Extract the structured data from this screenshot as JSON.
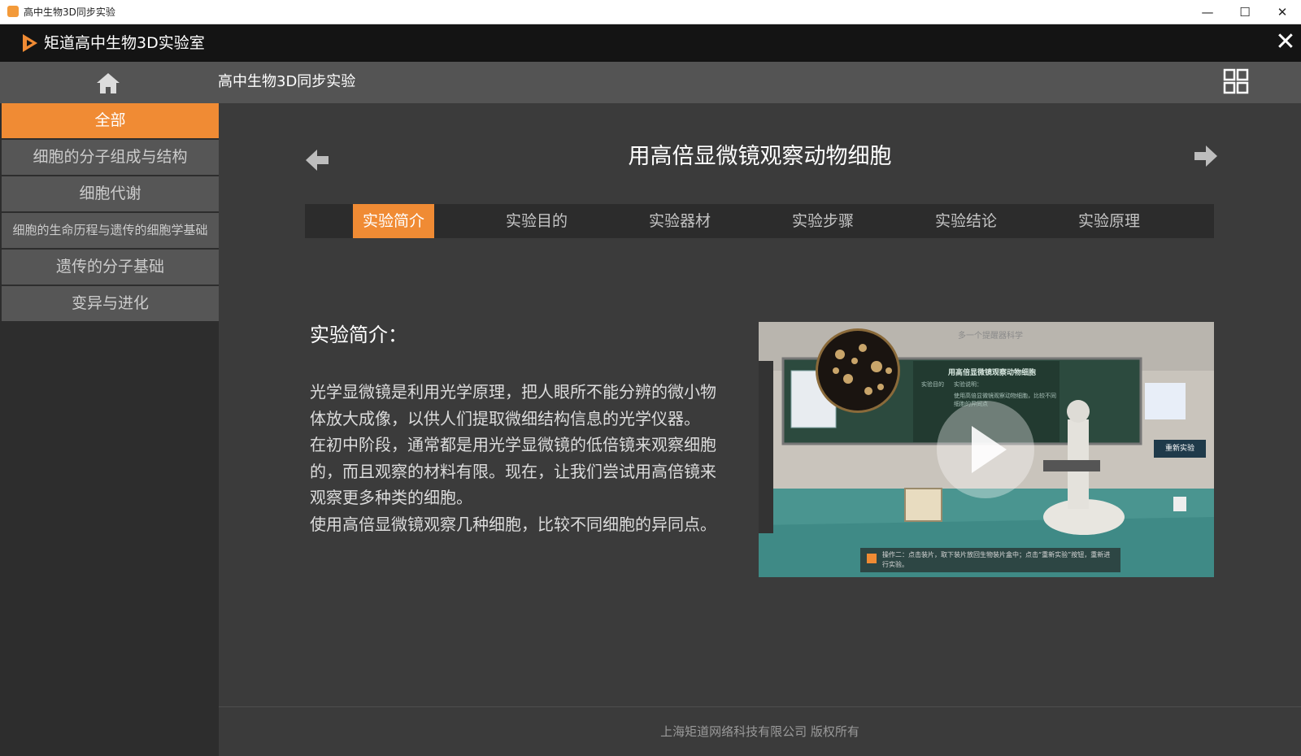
{
  "window": {
    "title": "高中生物3D同步实验",
    "minimize_label": "—",
    "maximize_label": "☐",
    "close_label": "✕"
  },
  "app": {
    "title": "矩道高中生物3D实验室",
    "close_label": "✕",
    "accent_color": "#f08b34"
  },
  "nav": {
    "title": "高中生物3D同步实验",
    "home_icon": "home-icon",
    "menu_icon": "grid-icon"
  },
  "sidebar": {
    "items": [
      {
        "label": "全部",
        "active": true
      },
      {
        "label": "细胞的分子组成与结构",
        "active": false
      },
      {
        "label": "细胞代谢",
        "active": false
      },
      {
        "label": "细胞的生命历程与遗传的细胞学基础",
        "active": false
      },
      {
        "label": "遗传的分子基础",
        "active": false
      },
      {
        "label": "变异与进化",
        "active": false
      }
    ]
  },
  "experiment": {
    "title": "用高倍显微镜观察动物细胞",
    "prev_icon": "arrow-left-icon",
    "next_icon": "arrow-right-icon",
    "tabs": [
      {
        "label": "实验简介",
        "active": true
      },
      {
        "label": "实验目的",
        "active": false
      },
      {
        "label": "实验器材",
        "active": false
      },
      {
        "label": "实验步骤",
        "active": false
      },
      {
        "label": "实验结论",
        "active": false
      },
      {
        "label": "实验原理",
        "active": false
      }
    ],
    "intro_heading": "实验简介：",
    "intro_paragraphs": [
      "光学显微镜是利用光学原理，把人眼所不能分辨的微小物体放大成像，以供人们提取微细结构信息的光学仪器。",
      "在初中阶段，通常都是用光学显微镜的低倍镜来观察细胞的，而且观察的材料有限。现在，让我们尝试用高倍镜来观察更多种类的细胞。",
      "使用高倍显微镜观察几种细胞，比较不同细胞的异同点。"
    ]
  },
  "video": {
    "watermark_logo": "多一个提醒器科学",
    "board_title": "用高倍显微镜观察动物细胞",
    "board_lines": [
      "实验目的",
      "实验说明：",
      "使用高倍显微镜观察动物细胞，比较不同",
      "细胞的异同点"
    ],
    "restart_label": "重新实验",
    "status_text": "操作二：点击装片，取下装片放回生物装片盒中；点击“重新实验”按钮，重新进行实验。",
    "play_icon": "play-icon"
  },
  "footer": {
    "copyright": "上海矩道网络科技有限公司  版权所有"
  }
}
